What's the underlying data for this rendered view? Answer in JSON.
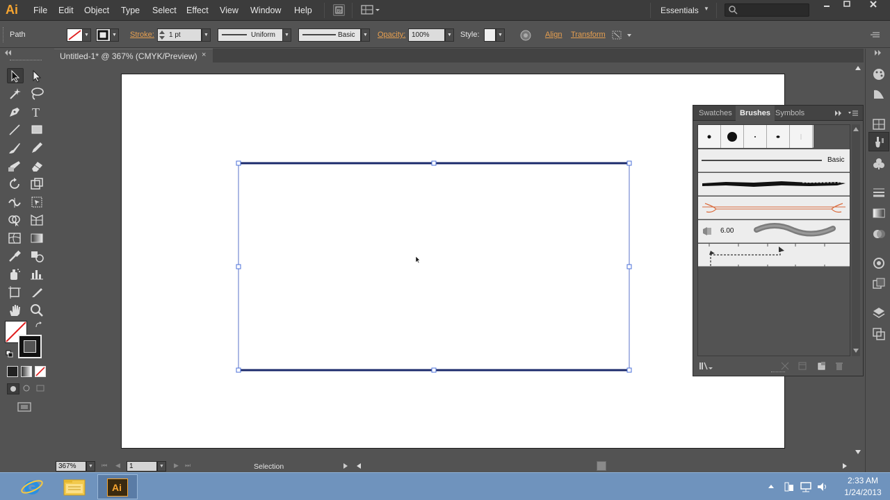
{
  "app": {
    "logo": "Ai",
    "workspace": "Essentials"
  },
  "menu": [
    "File",
    "Edit",
    "Object",
    "Type",
    "Select",
    "Effect",
    "View",
    "Window",
    "Help"
  ],
  "control_bar": {
    "selection_type": "Path",
    "stroke_label": "Stroke:",
    "stroke_weight": "1 pt",
    "profile": "Uniform",
    "brush": "Basic",
    "opacity_label": "Opacity:",
    "opacity": "100%",
    "style_label": "Style:",
    "align_label": "Align",
    "transform_label": "Transform"
  },
  "document": {
    "tab_title": "Untitled-1* @ 367% (CMYK/Preview)",
    "close": "×"
  },
  "status_bar": {
    "zoom": "367%",
    "artboard": "1",
    "tool": "Selection"
  },
  "brushes_panel": {
    "tabs": [
      "Swatches",
      "Brushes",
      "Symbols"
    ],
    "active_tab": "Brushes",
    "basic_label": "Basic",
    "bristle_value": "6.00"
  },
  "taskbar": {
    "time": "2:33 AM",
    "date": "1/24/2013",
    "ai_label": "Ai"
  },
  "colors": {
    "accent": "#f7a530",
    "selection": "#4a6fd8",
    "stroke_dark": "#1b2a6b"
  }
}
